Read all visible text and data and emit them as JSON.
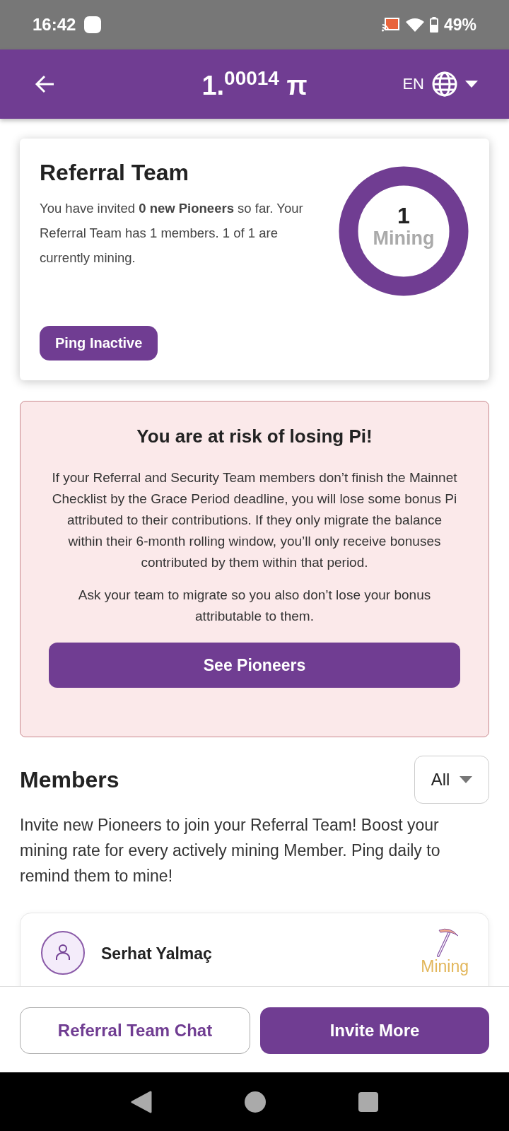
{
  "status_bar": {
    "time": "16:42",
    "battery": "49%"
  },
  "header": {
    "balance": "1.$^{00014}$ π",
    "language": "EN"
  },
  "referral_card": {
    "title": "Referral Team",
    "description": "You have invited **0 new Pioneers** so far. Your Referral Team has 1 members. 1 of 1 are currently mining.",
    "count": "1",
    "count_label": "Mining",
    "level": 1,
    "button": "Ping Inactive"
  },
  "warning": {
    "title": "You are at risk of losing Pi!",
    "paragraphs": [
      "If your Referral and Security Team members don’t finish the Mainnet Checklist by the Grace Period deadline, you will lose some bonus Pi attributed to their contributions. If they only migrate the balance within their 6-month rolling window, you’ll only receive bonuses contributed by them within that period.",
      "Ask your team to migrate so you also don’t lose your bonus attributable to them."
    ],
    "button": "See Pioneers"
  },
  "members": {
    "title": "Members",
    "filter": "All",
    "description": "Invite new Pioneers to join your Referral Team! Boost your mining rate for every actively mining Member. Ping daily to remind them to mine!",
    "list": [
      {
        "name": "Serhat Yalmaç",
        "status": "Mining"
      }
    ]
  },
  "bottom_buttons": [
    {
      "label": "Referral Team Chat",
      "kind": "outline"
    },
    {
      "label": "Invite More",
      "kind": "filled"
    }
  ]
}
